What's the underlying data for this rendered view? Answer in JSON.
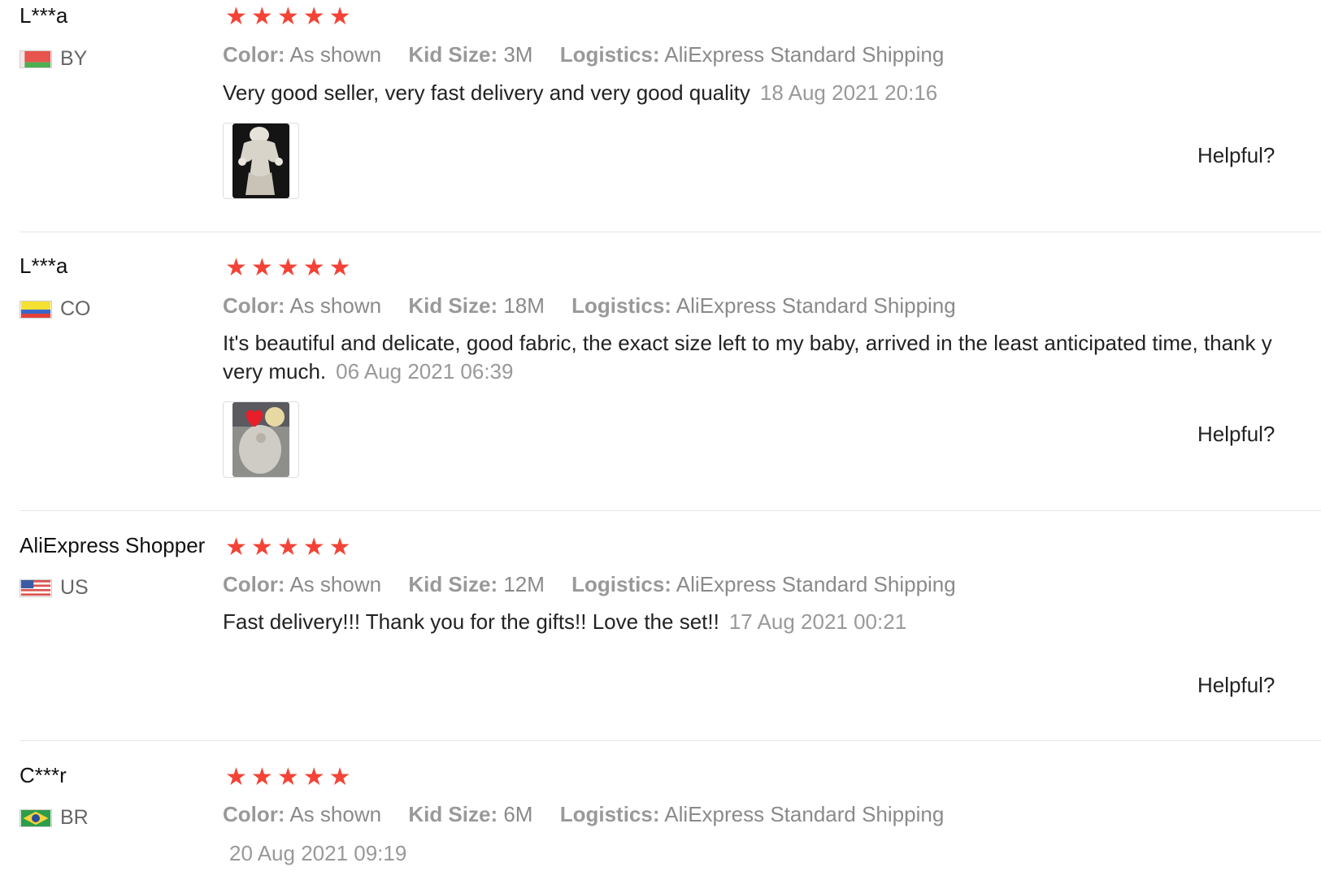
{
  "reviews": [
    {
      "user": "L***a",
      "country": "BY",
      "rating": 5,
      "color_label": "Color:",
      "color": "As shown",
      "size_label": "Kid Size:",
      "size": "3M",
      "logistics_label": "Logistics:",
      "logistics": "AliExpress Standard Shipping",
      "text": "Very good seller, very fast delivery and very good quality",
      "date": "18 Aug 2021 20:16",
      "helpful": "Helpful?"
    },
    {
      "user": "L***a",
      "country": "CO",
      "rating": 5,
      "color_label": "Color:",
      "color": "As shown",
      "size_label": "Kid Size:",
      "size": "18M",
      "logistics_label": "Logistics:",
      "logistics": "AliExpress Standard Shipping",
      "text_line1": "It's beautiful and delicate, good fabric, the exact size left to my baby, arrived in the least anticipated time, thank y",
      "text_line2": "very much.",
      "date": "06 Aug 2021 06:39",
      "helpful": "Helpful?"
    },
    {
      "user": "AliExpress Shopper",
      "country": "US",
      "rating": 5,
      "color_label": "Color:",
      "color": "As shown",
      "size_label": "Kid Size:",
      "size": "12M",
      "logistics_label": "Logistics:",
      "logistics": "AliExpress Standard Shipping",
      "text": "Fast delivery!!! Thank you for the gifts!! Love the set!!",
      "date": "17 Aug 2021 00:21",
      "helpful": "Helpful?"
    },
    {
      "user": "C***r",
      "country": "BR",
      "rating": 5,
      "color_label": "Color:",
      "color": "As shown",
      "size_label": "Kid Size:",
      "size": "6M",
      "logistics_label": "Logistics:",
      "logistics": "AliExpress Standard Shipping",
      "date": "20 Aug 2021 09:19"
    }
  ],
  "colors": {
    "star": "#f44336",
    "meta": "#999999",
    "divider": "#e6e6e6"
  }
}
